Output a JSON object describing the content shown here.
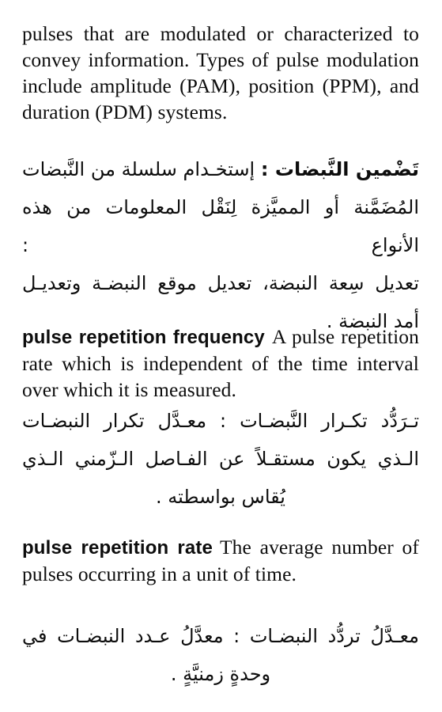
{
  "page": {
    "language_pair": "English-Arabic",
    "background_color": "#ffffff",
    "text_color": "#0d0d0d"
  },
  "entries": [
    {
      "id": "pulse-modulation-continued",
      "english": {
        "headword": "",
        "definition_lines": [
          "pulses that are modulated or characterized",
          "to convey information. Types of pulse",
          "modulation include amplitude (PAM),",
          "position (PPM), and duration (PDM)",
          "systems."
        ],
        "definition_text": "pulses that are modulated or characterized to convey information. Types of pulse modulation include amplitude (PAM), position (PPM), and duration (PDM) systems."
      },
      "arabic": {
        "headword": "تَضْمين النَّبضات",
        "separator": ":",
        "lines": [
          "تَضْمين النَّبضات : إستخـدام سلسلة من النَّبضات",
          "المُضَمَّنة أو المميَّزة لِنَقْل المعلومات من هذه الأنواع :",
          "تعديل سِعة النبضة، تعديل موقع النبضـة وتعديـل",
          "أمد النبضة ."
        ],
        "definition_text": "إستخـدام سلسلة من النَّبضات المُضَمَّنة أو المميَّزة لِنَقْل المعلومات من هذه الأنواع : تعديل سِعة النبضة، تعديل موقع النبضـة وتعديـل أمد النبضة ."
      }
    },
    {
      "id": "pulse-repetition-frequency",
      "english": {
        "headword": "pulse repetition frequency",
        "definition_lines": [
          "A pulse",
          "repetition rate which is independent of the",
          "time interval over which it is measured."
        ],
        "definition_text": "A pulse repetition rate which is independent of the time interval over which it is measured."
      },
      "arabic": {
        "headword": "تـرَدُّد تكـرار النَّبضات",
        "separator": ":",
        "lines": [
          "تـرَدُّد تكـرار النَّبضـات : معـدَّل تكرار النبضـات",
          "الـذي يكون مستقـلاً عن الفـاصل الـزّمني الـذي",
          "يُقاس بواسطته ."
        ],
        "definition_text": "معـدَّل تكرار النبضـات الـذي يكون مستقـلاً عن الفـاصل الـزّمني الـذي يُقاس بواسطته ."
      }
    },
    {
      "id": "pulse-repetition-rate",
      "english": {
        "headword": "pulse repetition rate",
        "definition_lines": [
          "The average",
          "number of pulses occurring in a unit of",
          "time."
        ],
        "definition_text": "The average number of pulses occurring in a unit of time."
      },
      "arabic": {
        "headword": "معـدَّلُ تردُّد النبضات",
        "separator": ":",
        "lines": [
          "معـدَّلُ تردُّد النبضـات : معدَّلُ عـدد النبضـات في",
          "وحدةٍ زمنيَّةٍ ."
        ],
        "definition_text": "معدَّلُ عـدد النبضـات في وحدةٍ زمنيَّةٍ ."
      }
    }
  ]
}
